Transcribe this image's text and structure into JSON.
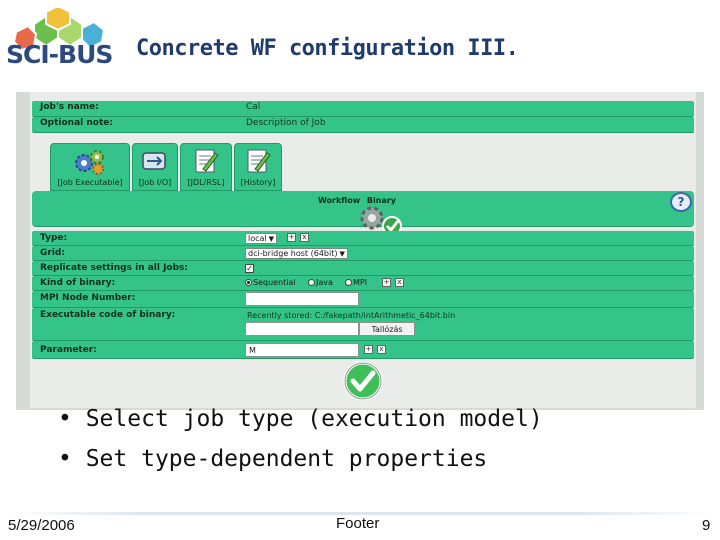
{
  "slide": {
    "title": "Concrete WF configuration III.",
    "logo_text": "SCI-BUS",
    "colors": {
      "title": "#1e3c6e",
      "panel_green": "#34c48a",
      "logo_blue": "#2c4a7c",
      "logo_green": "#6cbf4a"
    }
  },
  "job_header": {
    "rows": [
      {
        "label": "Job's name:",
        "value": "Cal"
      },
      {
        "label": "Optional note:",
        "value": "Description of Job"
      }
    ]
  },
  "tabs": [
    {
      "label": "[Job Executable]",
      "icon": "gears-icon"
    },
    {
      "label": "[Job I/O]",
      "icon": "io-icon"
    },
    {
      "label": "[JDL/RSL]",
      "icon": "document-pen-icon"
    },
    {
      "label": "[History]",
      "icon": "document-pen-icon"
    }
  ],
  "panel": {
    "heading_workflow": "Workflow",
    "heading_binary": "Binary",
    "help_symbol": "?",
    "help_icon": "help-icon",
    "fields": {
      "type": {
        "label": "Type:",
        "value": "local"
      },
      "grid": {
        "label": "Grid:",
        "value": "dci-bridge host (64bit)"
      },
      "replicate": {
        "label": "Replicate settings in all Jobs:"
      },
      "kind": {
        "label": "Kind of binary:",
        "options": [
          "Sequential",
          "Java",
          "MPI"
        ],
        "selected": "Sequential"
      },
      "mpi_nodes": {
        "label": "MPI Node Number:",
        "value": ""
      },
      "executable": {
        "label": "Executable code of binary:",
        "recently_stored": "Recently stored: C:/fakepath/intArithmetic_64bit.bin",
        "file_button": "Tallózás"
      },
      "parameter": {
        "label": "Parameter:",
        "value": "M"
      }
    },
    "ok_icon": "checkmark-icon"
  },
  "bullets": [
    "Select job type (execution model)",
    "Set type-dependent properties"
  ],
  "footer": {
    "date": "5/29/2006",
    "center": "Footer",
    "page": "9"
  }
}
